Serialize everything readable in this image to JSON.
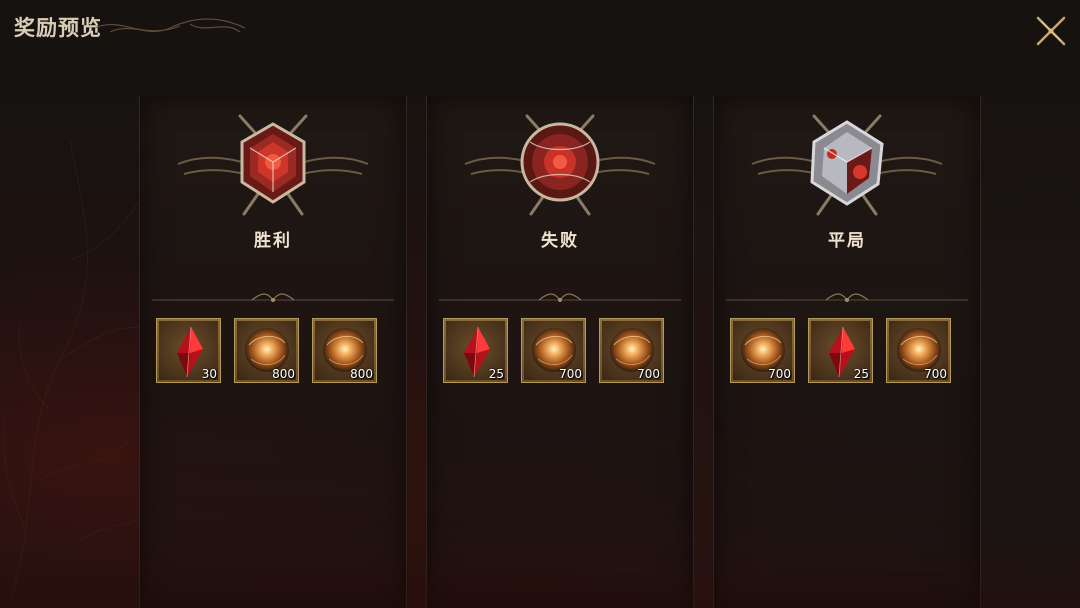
{
  "header": {
    "title": "奖励预览"
  },
  "panels": [
    {
      "label": "胜利",
      "emblem_style": "red",
      "rewards": [
        {
          "item": "red-crystal-icon",
          "qty": "30"
        },
        {
          "item": "orb-icon",
          "qty": "800"
        },
        {
          "item": "orb-icon",
          "qty": "800"
        }
      ]
    },
    {
      "label": "失败",
      "emblem_style": "red",
      "rewards": [
        {
          "item": "red-crystal-icon",
          "qty": "25"
        },
        {
          "item": "orb-icon",
          "qty": "700"
        },
        {
          "item": "orb-icon",
          "qty": "700"
        }
      ]
    },
    {
      "label": "平局",
      "emblem_style": "silver",
      "rewards": [
        {
          "item": "orb-icon",
          "qty": "700"
        },
        {
          "item": "red-crystal-icon",
          "qty": "25"
        },
        {
          "item": "orb-icon",
          "qty": "700"
        }
      ]
    }
  ],
  "colors": {
    "gold_border": "#b59a5e",
    "crystal": "#d8141c",
    "orb": "#f0a050",
    "background": "#1a1412"
  },
  "icons": {
    "close": "close-x-icon"
  }
}
